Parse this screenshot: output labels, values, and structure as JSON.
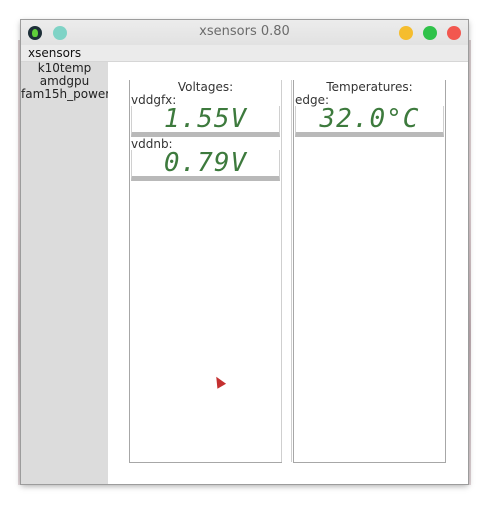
{
  "window": {
    "title": "xsensors 0.80"
  },
  "menubar": {
    "items": [
      "xsensors"
    ]
  },
  "sidebar": {
    "items": [
      "k10temp",
      "amdgpu",
      "fam15h_power"
    ]
  },
  "panels": {
    "voltages": {
      "title": "Voltages:",
      "sensors": [
        {
          "label": "vddgfx:",
          "value": "1.55V"
        },
        {
          "label": "vddnb:",
          "value": "0.79V"
        }
      ]
    },
    "temperatures": {
      "title": "Temperatures:",
      "sensors": [
        {
          "label": "edge:",
          "value": "32.0°C"
        }
      ]
    }
  },
  "colors": {
    "lcd_text": "#3d7a3d",
    "close": "#f2574f",
    "minimize": "#f5bd2e",
    "maximize": "#2fc24a"
  }
}
